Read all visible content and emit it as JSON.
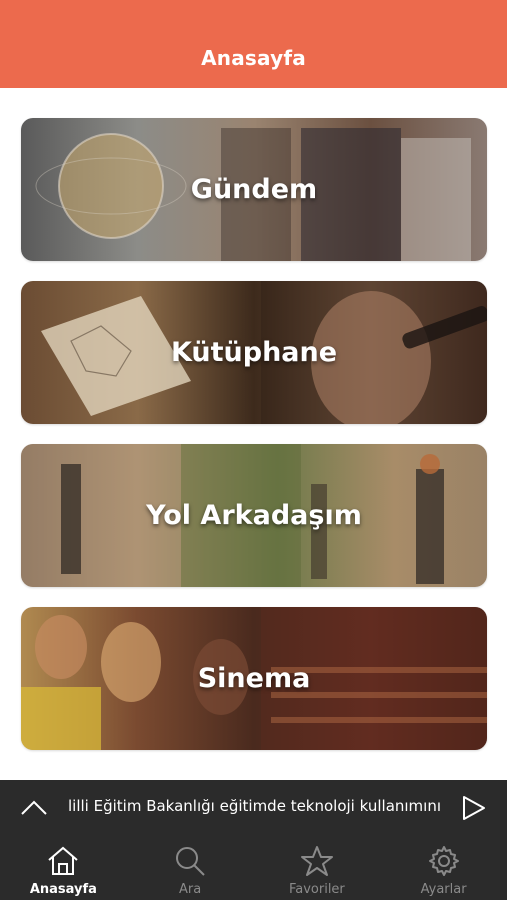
{
  "header": {
    "title": "Anasayfa"
  },
  "cards": [
    {
      "label": "Gündem"
    },
    {
      "label": "Kütüphane"
    },
    {
      "label": "Yol Arkadaşım"
    },
    {
      "label": "Sinema"
    }
  ],
  "ticker": {
    "text": "lilli Eğitim Bakanlığı eğitimde teknoloji kullanımını π",
    "expand_icon": "chevron-up-icon",
    "play_icon": "play-icon"
  },
  "tabbar": {
    "items": [
      {
        "label": "Anasayfa",
        "icon": "home-icon",
        "active": true
      },
      {
        "label": "Ara",
        "icon": "search-icon",
        "active": false
      },
      {
        "label": "Favoriler",
        "icon": "star-icon",
        "active": false
      },
      {
        "label": "Ayarlar",
        "icon": "gear-icon",
        "active": false
      }
    ]
  },
  "colors": {
    "header": "#ec6a4d",
    "bar": "#2b2b2b",
    "active_tab": "#ffffff",
    "inactive_tab": "#8a8a8a"
  }
}
